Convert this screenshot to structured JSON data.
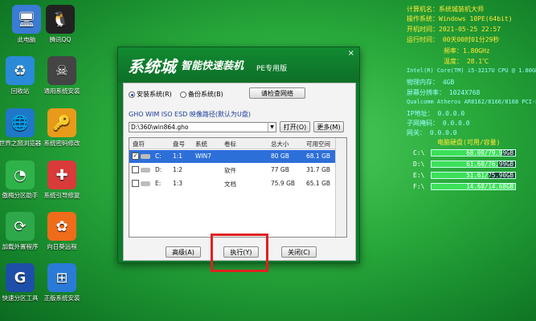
{
  "desktop": [
    {
      "label": "此电脑",
      "color": "#3a7bd5",
      "glyph": "🖥"
    },
    {
      "label": "腾讯QQ",
      "color": "#222",
      "glyph": "🐧"
    },
    {
      "label": "回收站",
      "color": "#2a8ad8",
      "glyph": "♻"
    },
    {
      "label": "通用系统安装",
      "color": "#444",
      "glyph": "☠"
    },
    {
      "label": "世界之窗浏览器",
      "color": "#1f77c8",
      "glyph": "🌐"
    },
    {
      "label": "系统密码修改",
      "color": "#e89a1b",
      "glyph": "🔑"
    },
    {
      "label": "傲梅分区助手",
      "color": "#2fb24a",
      "glyph": "◔"
    },
    {
      "label": "系统引导修复",
      "color": "#d93a3a",
      "glyph": "✚"
    },
    {
      "label": "加载外置程序",
      "color": "#2ea84a",
      "glyph": "⟳"
    },
    {
      "label": "向日葵远程",
      "color": "#ef6c1a",
      "glyph": "✿"
    },
    {
      "label": "快速分区工具",
      "color": "#1d4fa8",
      "glyph": "G"
    },
    {
      "label": "正版系统安装",
      "color": "#2a7bd8",
      "glyph": "⊞"
    }
  ],
  "window": {
    "title_main": "系统城",
    "title_sub": "智能快速装机",
    "title_edition": "PE专用版",
    "close": "×",
    "radio_install": "安装系统(R)",
    "radio_backup": "备份系统(B)",
    "network_button": "请检查网络",
    "path_label": "GHO WIM ISO ESD 映像路径(默认为U盘)",
    "path_value": "D:\\360\\win864.gho",
    "open_button": "打开(O)",
    "more_button": "更多(M)",
    "columns": [
      "盘符",
      "盘号",
      "系统",
      "卷标",
      "总大小",
      "可用空间"
    ],
    "rows": [
      {
        "drive": "C:",
        "num": "1:1",
        "system": "WIN7",
        "label": "",
        "total": "80 GB",
        "free": "68.1 GB",
        "checked": true
      },
      {
        "drive": "D:",
        "num": "1:2",
        "system": "",
        "label": "软件",
        "total": "77 GB",
        "free": "31.7 GB",
        "checked": false
      },
      {
        "drive": "E:",
        "num": "1:3",
        "system": "",
        "label": "文档",
        "total": "75.9 GB",
        "free": "65.1 GB",
        "checked": false
      }
    ],
    "advanced_button": "高级(A)",
    "execute_button": "执行(Y)",
    "close_button": "关闭(C)"
  },
  "sysinfo": {
    "l1": "计算机名：系统城装机大师",
    "l2": "操作系统：Windows 10PE(64bit)",
    "l3": "开机时间：2021-05-25 22:57",
    "l4": "运行时间：    00天00时01分29秒",
    "l5": "频率：1.80GHz",
    "l6": "温度：   28.1℃",
    "l7": "Intel(R) Core(TM) i5-3217U CPU @ 1.80GHz",
    "l8": "物理内存：    4GB",
    "l9": "屏幕分辨率：    1024X768",
    "l10": "Qualcomm Atheros AR8162/8166/8168 PCI-E",
    "l11": "IP地址：   0.0.0.0",
    "l12": "子网掩码：   0.0.0.0",
    "l13": "网关：    0.0.0.0",
    "disk_title": "电脑硬盘(可用/容量)",
    "disks": [
      {
        "name": "C:\\",
        "text": "68.08/79.99GB",
        "fill": 0.85
      },
      {
        "name": "D:\\",
        "text": "61.60/76.99GB",
        "fill": 0.8
      },
      {
        "name": "E:\\",
        "text": "51.61/75.90GB",
        "fill": 0.68
      },
      {
        "name": "F:\\",
        "text": "14.68/14.68GB",
        "fill": 1.0
      }
    ]
  }
}
